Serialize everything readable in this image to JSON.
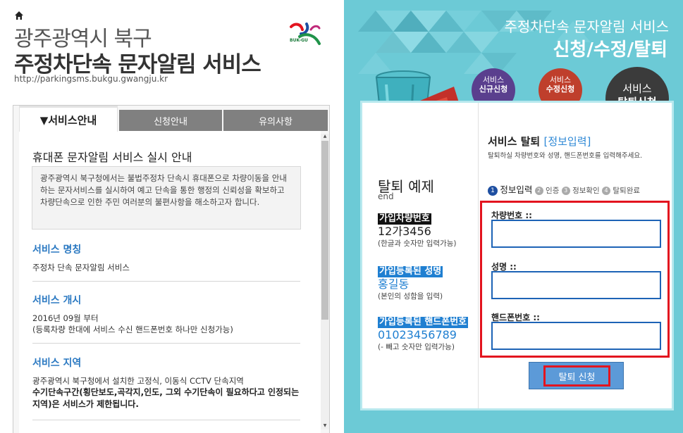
{
  "header": {
    "title_line1": "광주광역시 북구",
    "title_line2": "주정차단속 문자알림 서비스",
    "url": "http://parkingsms.bukgu.gwangju.kr",
    "logo_text": "BUK-GU"
  },
  "tabs": [
    {
      "label": "▼서비스안내",
      "active": true
    },
    {
      "label": "신청안내",
      "active": false
    },
    {
      "label": "유의사항",
      "active": false
    }
  ],
  "notice": {
    "title": "휴대폰 문자알림 서비스 실시 안내",
    "body": "광주광역시 북구청에서는 불법주정차 단속시 휴대폰으로 차량이동을 안내하는 문자서비스를 실시하여 예고 단속을 통한 행정의 신뢰성을 확보하고 차량단속으로 인한 주민 여러분의 불편사항을 해소하고자 합니다."
  },
  "sections": [
    {
      "title": "서비스 명칭",
      "text": "주정차 단속 문자알림 서비스"
    },
    {
      "title": "서비스 개시",
      "text_line1": "2016년 09월 부터",
      "text_line2": "(등록차량 한대에 서비스 수신 핸드폰번호 하나만 신청가능)"
    },
    {
      "title": "서비스 지역",
      "text_line1": "광주광역시 북구청에서 설치한 고정식, 이동식 CCTV 단속지역",
      "text_bold": "수기단속구간(횡단보도,곡각지,인도, 그외 수기단속이 필요하다고 인정되는 지역)은 서비스가 제한됩니다."
    }
  ],
  "right": {
    "title_line1": "주정차단속 문자알림 서비스",
    "title_line2": "신청/수정/탈퇴",
    "circles": [
      {
        "line1": "서비스",
        "line2": "신규신청"
      },
      {
        "line1": "서비스",
        "line2": "수정신청"
      },
      {
        "line1": "서비스",
        "line2": "탈퇴신청"
      }
    ],
    "example": {
      "title": "탈퇴 예제",
      "subtitle": "end",
      "car_label": "가입차량번호",
      "car_value": "12가3456",
      "car_hint": "(한글과 숫자만 입력가능)",
      "name_label": "가입등록된 성명",
      "name_value": "홍길동",
      "name_hint": "(본인의 성함을 입력)",
      "phone_label": "가입등록된 핸드폰번호",
      "phone_value": "01023456789",
      "phone_hint": "(- 빼고 숫자만 입력가능)"
    },
    "form": {
      "title": "서비스 탈퇴",
      "title_accent": "[정보입력]",
      "desc": "탈퇴하실 차량번호와 성명, 핸드폰번호를 입력해주세요.",
      "steps": [
        {
          "num": "1",
          "label": "정보입력"
        },
        {
          "num": "2",
          "label": "인증"
        },
        {
          "num": "3",
          "label": "정보확인"
        },
        {
          "num": "4",
          "label": "탈퇴완료"
        }
      ],
      "car_label": "차량번호 ::",
      "name_label": "성명 ::",
      "phone_label": "핸드폰번호 ::",
      "car_value": "",
      "name_value": "",
      "phone_value": "",
      "submit_label": "탈퇴 신청"
    }
  },
  "colors": {
    "accent_blue": "#2b79c2",
    "panel_teal": "#6ccad6",
    "highlight_red": "#e3141f",
    "circle_purple": "#5a3f8e",
    "circle_red": "#bf3f2c",
    "circle_dark": "#3b3b3b"
  }
}
